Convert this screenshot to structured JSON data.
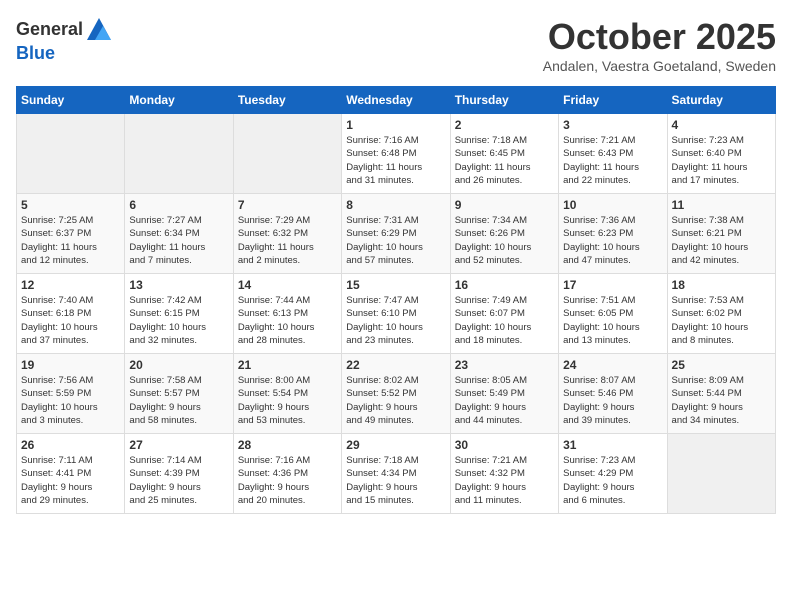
{
  "header": {
    "logo_general": "General",
    "logo_blue": "Blue",
    "month_title": "October 2025",
    "subtitle": "Andalen, Vaestra Goetaland, Sweden"
  },
  "days_of_week": [
    "Sunday",
    "Monday",
    "Tuesday",
    "Wednesday",
    "Thursday",
    "Friday",
    "Saturday"
  ],
  "weeks": [
    [
      {
        "day": "",
        "info": ""
      },
      {
        "day": "",
        "info": ""
      },
      {
        "day": "",
        "info": ""
      },
      {
        "day": "1",
        "info": "Sunrise: 7:16 AM\nSunset: 6:48 PM\nDaylight: 11 hours\nand 31 minutes."
      },
      {
        "day": "2",
        "info": "Sunrise: 7:18 AM\nSunset: 6:45 PM\nDaylight: 11 hours\nand 26 minutes."
      },
      {
        "day": "3",
        "info": "Sunrise: 7:21 AM\nSunset: 6:43 PM\nDaylight: 11 hours\nand 22 minutes."
      },
      {
        "day": "4",
        "info": "Sunrise: 7:23 AM\nSunset: 6:40 PM\nDaylight: 11 hours\nand 17 minutes."
      }
    ],
    [
      {
        "day": "5",
        "info": "Sunrise: 7:25 AM\nSunset: 6:37 PM\nDaylight: 11 hours\nand 12 minutes."
      },
      {
        "day": "6",
        "info": "Sunrise: 7:27 AM\nSunset: 6:34 PM\nDaylight: 11 hours\nand 7 minutes."
      },
      {
        "day": "7",
        "info": "Sunrise: 7:29 AM\nSunset: 6:32 PM\nDaylight: 11 hours\nand 2 minutes."
      },
      {
        "day": "8",
        "info": "Sunrise: 7:31 AM\nSunset: 6:29 PM\nDaylight: 10 hours\nand 57 minutes."
      },
      {
        "day": "9",
        "info": "Sunrise: 7:34 AM\nSunset: 6:26 PM\nDaylight: 10 hours\nand 52 minutes."
      },
      {
        "day": "10",
        "info": "Sunrise: 7:36 AM\nSunset: 6:23 PM\nDaylight: 10 hours\nand 47 minutes."
      },
      {
        "day": "11",
        "info": "Sunrise: 7:38 AM\nSunset: 6:21 PM\nDaylight: 10 hours\nand 42 minutes."
      }
    ],
    [
      {
        "day": "12",
        "info": "Sunrise: 7:40 AM\nSunset: 6:18 PM\nDaylight: 10 hours\nand 37 minutes."
      },
      {
        "day": "13",
        "info": "Sunrise: 7:42 AM\nSunset: 6:15 PM\nDaylight: 10 hours\nand 32 minutes."
      },
      {
        "day": "14",
        "info": "Sunrise: 7:44 AM\nSunset: 6:13 PM\nDaylight: 10 hours\nand 28 minutes."
      },
      {
        "day": "15",
        "info": "Sunrise: 7:47 AM\nSunset: 6:10 PM\nDaylight: 10 hours\nand 23 minutes."
      },
      {
        "day": "16",
        "info": "Sunrise: 7:49 AM\nSunset: 6:07 PM\nDaylight: 10 hours\nand 18 minutes."
      },
      {
        "day": "17",
        "info": "Sunrise: 7:51 AM\nSunset: 6:05 PM\nDaylight: 10 hours\nand 13 minutes."
      },
      {
        "day": "18",
        "info": "Sunrise: 7:53 AM\nSunset: 6:02 PM\nDaylight: 10 hours\nand 8 minutes."
      }
    ],
    [
      {
        "day": "19",
        "info": "Sunrise: 7:56 AM\nSunset: 5:59 PM\nDaylight: 10 hours\nand 3 minutes."
      },
      {
        "day": "20",
        "info": "Sunrise: 7:58 AM\nSunset: 5:57 PM\nDaylight: 9 hours\nand 58 minutes."
      },
      {
        "day": "21",
        "info": "Sunrise: 8:00 AM\nSunset: 5:54 PM\nDaylight: 9 hours\nand 53 minutes."
      },
      {
        "day": "22",
        "info": "Sunrise: 8:02 AM\nSunset: 5:52 PM\nDaylight: 9 hours\nand 49 minutes."
      },
      {
        "day": "23",
        "info": "Sunrise: 8:05 AM\nSunset: 5:49 PM\nDaylight: 9 hours\nand 44 minutes."
      },
      {
        "day": "24",
        "info": "Sunrise: 8:07 AM\nSunset: 5:46 PM\nDaylight: 9 hours\nand 39 minutes."
      },
      {
        "day": "25",
        "info": "Sunrise: 8:09 AM\nSunset: 5:44 PM\nDaylight: 9 hours\nand 34 minutes."
      }
    ],
    [
      {
        "day": "26",
        "info": "Sunrise: 7:11 AM\nSunset: 4:41 PM\nDaylight: 9 hours\nand 29 minutes."
      },
      {
        "day": "27",
        "info": "Sunrise: 7:14 AM\nSunset: 4:39 PM\nDaylight: 9 hours\nand 25 minutes."
      },
      {
        "day": "28",
        "info": "Sunrise: 7:16 AM\nSunset: 4:36 PM\nDaylight: 9 hours\nand 20 minutes."
      },
      {
        "day": "29",
        "info": "Sunrise: 7:18 AM\nSunset: 4:34 PM\nDaylight: 9 hours\nand 15 minutes."
      },
      {
        "day": "30",
        "info": "Sunrise: 7:21 AM\nSunset: 4:32 PM\nDaylight: 9 hours\nand 11 minutes."
      },
      {
        "day": "31",
        "info": "Sunrise: 7:23 AM\nSunset: 4:29 PM\nDaylight: 9 hours\nand 6 minutes."
      },
      {
        "day": "",
        "info": ""
      }
    ]
  ]
}
